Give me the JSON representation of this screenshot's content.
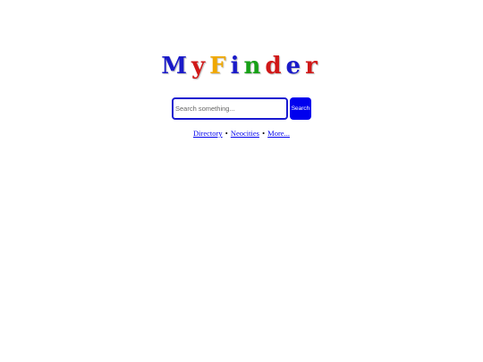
{
  "logo": {
    "letters": [
      {
        "char": "M",
        "color": "#1a1ac8"
      },
      {
        "char": "y",
        "color": "#d01818"
      },
      {
        "char": "F",
        "color": "#f0a800"
      },
      {
        "char": "i",
        "color": "#1a1ac8"
      },
      {
        "char": "n",
        "color": "#16a016"
      },
      {
        "char": "d",
        "color": "#d01818"
      },
      {
        "char": "e",
        "color": "#1a1ac8"
      },
      {
        "char": "r",
        "color": "#d01818"
      }
    ]
  },
  "search": {
    "placeholder": "Search something...",
    "value": "",
    "button_label": "Search"
  },
  "links": {
    "items": [
      "Directory",
      "Neocities",
      "More..."
    ],
    "separator": "•"
  },
  "colors": {
    "accent": "#0000ee",
    "input_border": "#1a1ad0"
  }
}
